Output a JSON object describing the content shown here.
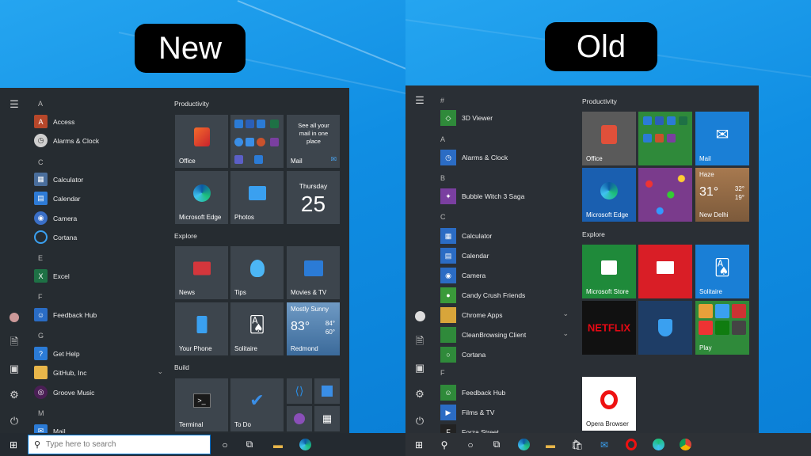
{
  "labels": {
    "new": "New",
    "old": "Old"
  },
  "new": {
    "letters": [
      "A",
      "C",
      "E",
      "F",
      "G",
      "M"
    ],
    "apps": [
      {
        "label": "Access",
        "icon": "access-icon",
        "color": "#b7472a",
        "glyph": "A"
      },
      {
        "label": "Alarms & Clock",
        "icon": "alarms-clock-icon",
        "color": "#cfcfcf",
        "glyph": "◷"
      },
      {
        "label": "Calculator",
        "icon": "calculator-icon",
        "color": "#4a6e9c",
        "glyph": "▦"
      },
      {
        "label": "Calendar",
        "icon": "calendar-icon",
        "color": "#2e7bd6",
        "glyph": "▤"
      },
      {
        "label": "Camera",
        "icon": "camera-icon",
        "color": "#3a6fc7",
        "glyph": "◉"
      },
      {
        "label": "Cortana",
        "icon": "cortana-icon",
        "color": "transparent",
        "glyph": "○"
      },
      {
        "label": "Excel",
        "icon": "excel-icon",
        "color": "#1e7145",
        "glyph": "X"
      },
      {
        "label": "Feedback Hub",
        "icon": "feedback-hub-icon",
        "color": "#2a6cc4",
        "glyph": "☺"
      },
      {
        "label": "Get Help",
        "icon": "get-help-icon",
        "color": "#2b7bd6",
        "glyph": "?"
      },
      {
        "label": "GitHub, Inc",
        "icon": "folder-icon",
        "color": "#e8b64a",
        "glyph": ""
      },
      {
        "label": "Groove Music",
        "icon": "groove-music-icon",
        "color": "#7a2f86",
        "glyph": "◎"
      },
      {
        "label": "Mail",
        "icon": "mail-icon",
        "color": "#2b7bd6",
        "glyph": "✉"
      }
    ],
    "groups": [
      "Productivity",
      "Explore",
      "Build"
    ],
    "tiles": {
      "office": "Office",
      "mail": "Mail",
      "mail_text": "See all your mail in one place",
      "edge": "Microsoft Edge",
      "photos": "Photos",
      "calendar_day": "Thursday",
      "calendar_date": "25",
      "news": "News",
      "tips": "Tips",
      "movies": "Movies & TV",
      "weather_cond": "Mostly Sunny",
      "weather_temp": "83°",
      "weather_hi": "84°",
      "weather_lo": "60°",
      "weather_city": "Redmond",
      "phone": "Your Phone",
      "solitaire": "Solitaire",
      "terminal": "Terminal",
      "todo": "To Do"
    },
    "search": {
      "placeholder": "Type here to search"
    }
  },
  "old": {
    "letters": [
      "#",
      "A",
      "B",
      "C",
      "F"
    ],
    "apps": [
      {
        "label": "3D Viewer",
        "icon": "3d-viewer-icon",
        "color": "#2f8a3a",
        "glyph": "◇"
      },
      {
        "label": "Alarms & Clock",
        "icon": "alarms-clock-icon",
        "color": "#2b6cc4",
        "glyph": "◷"
      },
      {
        "label": "Bubble Witch 3 Saga",
        "icon": "bubble-witch-icon",
        "color": "#7a3fa0",
        "glyph": "✦"
      },
      {
        "label": "Calculator",
        "icon": "calculator-icon",
        "color": "#2b6cc4",
        "glyph": "▦"
      },
      {
        "label": "Calendar",
        "icon": "calendar-icon",
        "color": "#2b6cc4",
        "glyph": "▤"
      },
      {
        "label": "Camera",
        "icon": "camera-icon",
        "color": "#2b6cc4",
        "glyph": "◉"
      },
      {
        "label": "Candy Crush Friends",
        "icon": "candy-crush-icon",
        "color": "#3a9a3a",
        "glyph": "●"
      },
      {
        "label": "Chrome Apps",
        "icon": "chrome-apps-icon",
        "color": "#d8a53a",
        "glyph": ""
      },
      {
        "label": "CleanBrowsing Client",
        "icon": "cleanbrowsing-icon",
        "color": "#2f8a3a",
        "glyph": ""
      },
      {
        "label": "Cortana",
        "icon": "cortana-icon",
        "color": "#2f8a3a",
        "glyph": "○"
      },
      {
        "label": "Feedback Hub",
        "icon": "feedback-hub-icon",
        "color": "#2f8a3a",
        "glyph": "☺"
      },
      {
        "label": "Films & TV",
        "icon": "films-tv-icon",
        "color": "#2b6cc4",
        "glyph": "▶"
      },
      {
        "label": "Forza Street",
        "icon": "forza-street-icon",
        "color": "#222",
        "glyph": "F"
      }
    ],
    "groups": [
      "Productivity",
      "Explore"
    ],
    "tiles": {
      "office": "Office",
      "mail": "Mail",
      "edge": "Microsoft Edge",
      "weather_cond": "Haze",
      "weather_temp": "31°",
      "weather_hi": "32°",
      "weather_lo": "19°",
      "weather_city": "New Delhi",
      "store": "Microsoft Store",
      "solitaire": "Solitaire",
      "netflix": "NETFLIX",
      "play": "Play",
      "opera": "Opera Browser"
    }
  }
}
